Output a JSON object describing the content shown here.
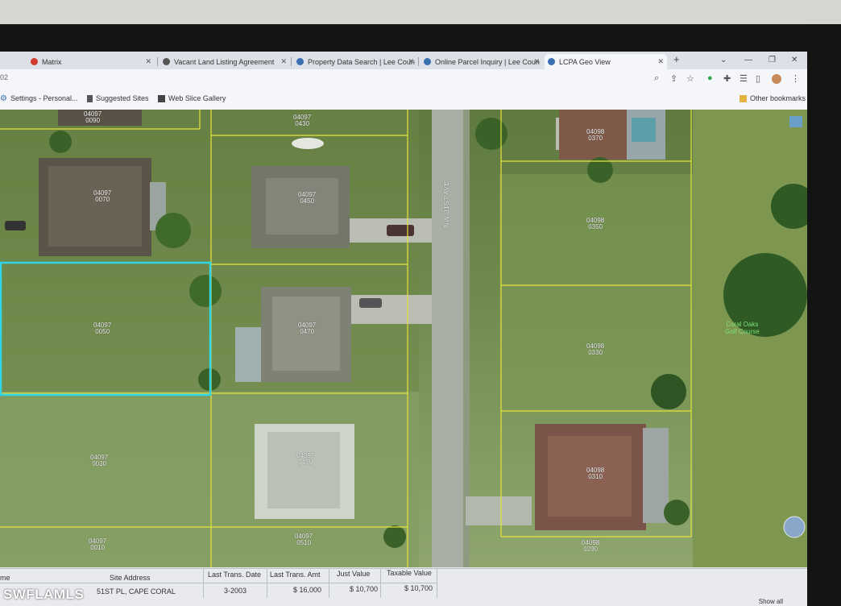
{
  "browser": {
    "tabs": [
      {
        "label": "Matrix",
        "favicon_color": "#d33a2c"
      },
      {
        "label": "Vacant Land Listing Agreement",
        "favicon_color": "#555555"
      },
      {
        "label": "Property Data Search | Lee Coun",
        "favicon_color": "#3a6fb0"
      },
      {
        "label": "Online Parcel Inquiry | Lee Coun",
        "favicon_color": "#3a6fb0"
      },
      {
        "label": "LCPA Geo View",
        "favicon_color": "#3a6fb0"
      }
    ],
    "new_tab_icon": "plus-icon",
    "address_fragment": "02",
    "bookmarks": [
      {
        "label": "Settings - Personal...",
        "icon": "gear-icon"
      },
      {
        "label": "Suggested Sites",
        "icon": "bookmark-icon"
      },
      {
        "label": "Web Slice Gallery",
        "icon": "web-slice-icon"
      }
    ],
    "other_bookmarks": "Other bookmarks"
  },
  "map": {
    "street_name": "NW 31ST AVE",
    "parcels": [
      {
        "code": "04097",
        "sub": "0090"
      },
      {
        "code": "04097",
        "sub": "0430"
      },
      {
        "code": "04098",
        "sub": "0370"
      },
      {
        "code": "04097",
        "sub": "0070"
      },
      {
        "code": "04097",
        "sub": "0450"
      },
      {
        "code": "04098",
        "sub": "0350"
      },
      {
        "code": "04097",
        "sub": "0050"
      },
      {
        "code": "04097",
        "sub": "0470"
      },
      {
        "code": "04098",
        "sub": "0330"
      },
      {
        "code": "04097",
        "sub": "0030"
      },
      {
        "code": "04097",
        "sub": "0490"
      },
      {
        "code": "04098",
        "sub": "0310"
      },
      {
        "code": "04097",
        "sub": "0010"
      },
      {
        "code": "04097",
        "sub": "0510"
      },
      {
        "code": "04098",
        "sub": "0290"
      }
    ],
    "golf_label_line1": "Coral Oaks",
    "golf_label_line2": "Golf Course",
    "selected_parcel_color": "#2fd6e8",
    "parcel_line_color": "#e8e23a"
  },
  "results": {
    "headers": {
      "col0": "me",
      "site_address": "Site Address",
      "last_trans_date": "Last Trans. Date",
      "last_trans_amt": "Last Trans. Amt",
      "just_value": "Just Value",
      "taxable_value": "Taxable Value"
    },
    "row": {
      "site_address": "51ST PL, CAPE CORAL",
      "last_trans_date": "3-2003",
      "last_trans_amt": "$ 16,000",
      "just_value": "$ 10,700",
      "taxable_value": "$ 10,700"
    },
    "show_all": "Show all"
  },
  "watermark": "SWFLAMLS"
}
